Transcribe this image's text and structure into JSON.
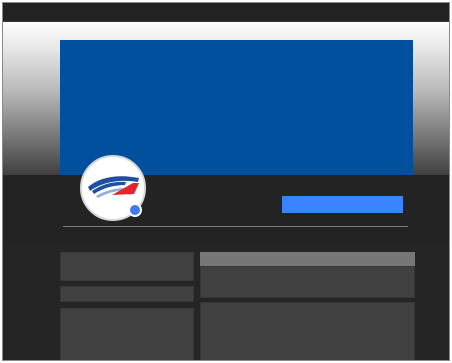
{
  "window": {
    "title": ""
  },
  "profile": {
    "name": "",
    "action_label": "",
    "status": "online"
  },
  "icons": {
    "avatar": "train-logo-icon",
    "status": "status-dot-icon"
  },
  "colors": {
    "cover": "#00509e",
    "accent_button": "#3b84ff",
    "status_dot": "#3b7bea",
    "logo_blue": "#1e4fa0",
    "logo_red": "#e8222a"
  },
  "sidebar": {
    "cards": [
      "",
      "",
      ""
    ]
  },
  "main": {
    "header": "",
    "cards": [
      "",
      ""
    ]
  }
}
